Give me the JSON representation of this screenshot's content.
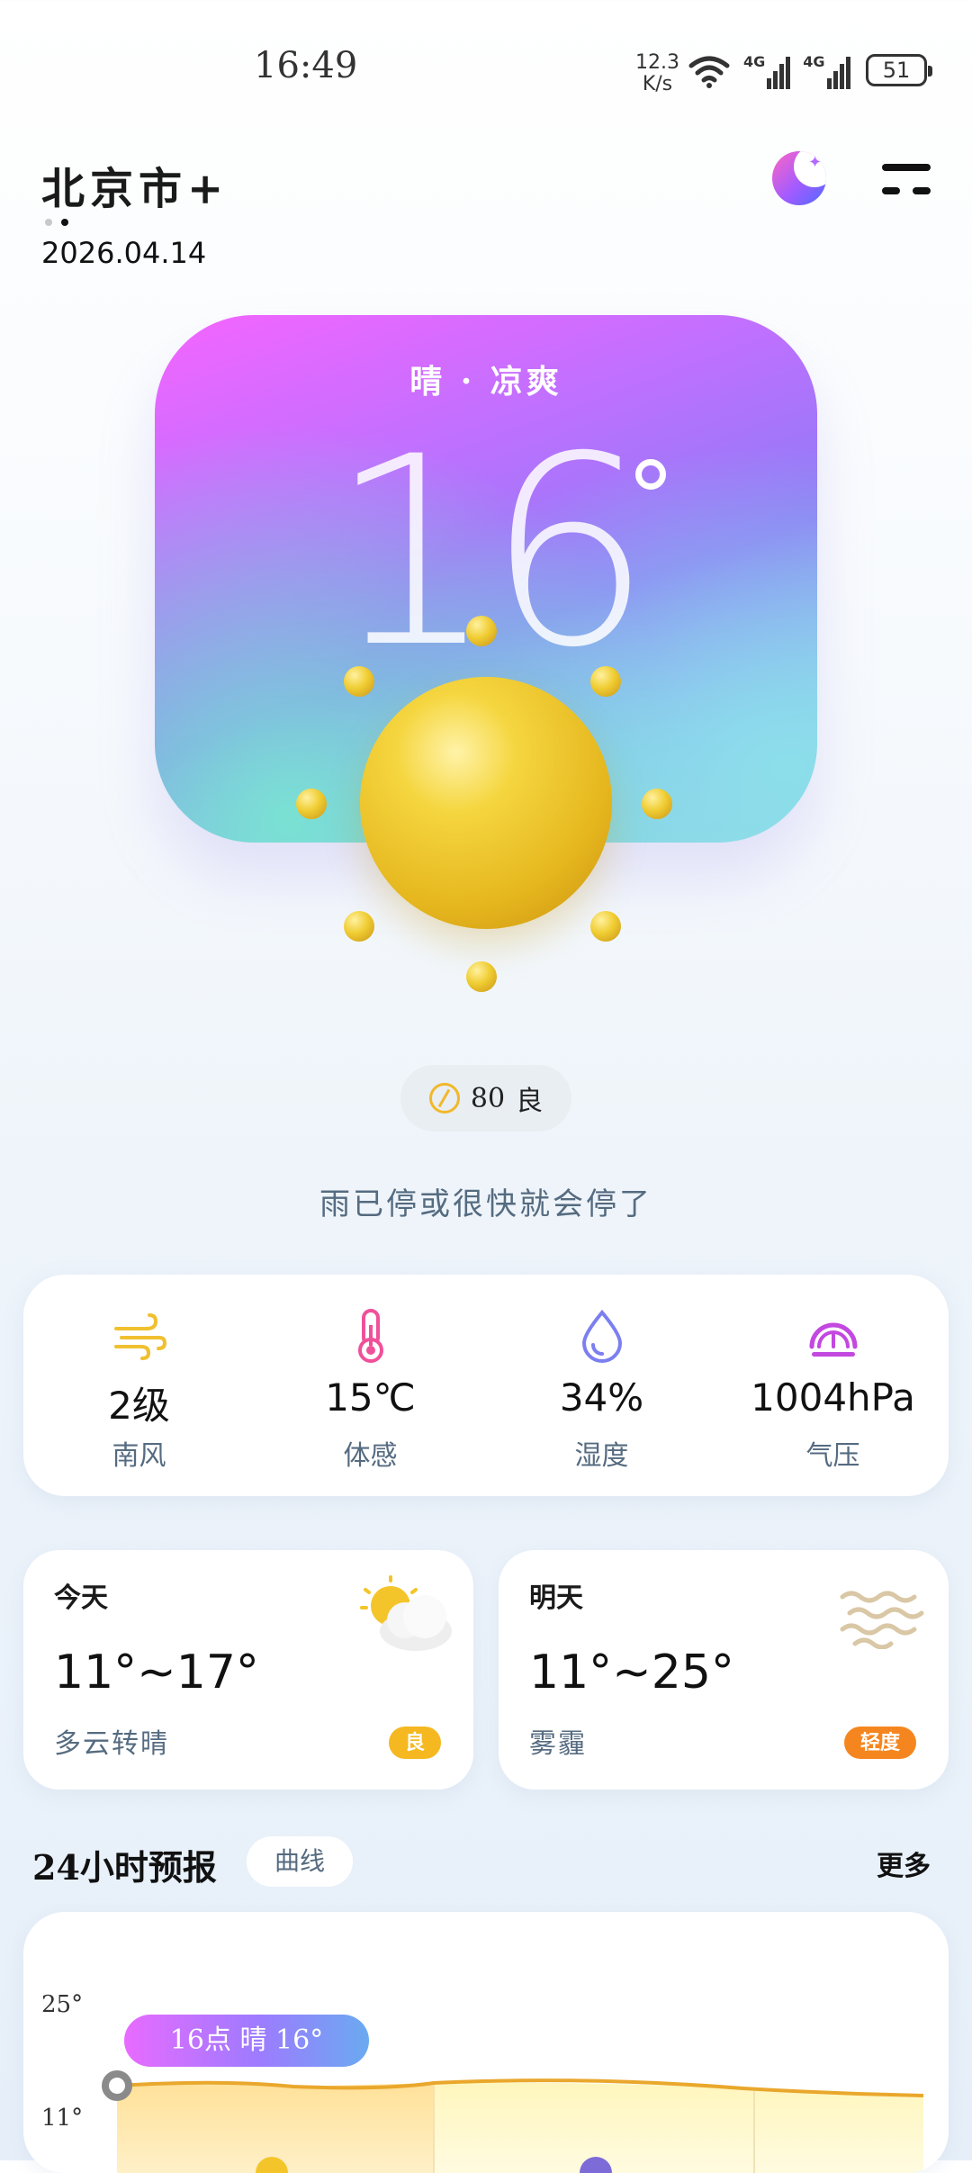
{
  "status_bar": {
    "time": "16:49",
    "net_speed_value": "12.3",
    "net_speed_unit": "K/s",
    "signal_1": "4G",
    "signal_2": "4G",
    "battery": "51",
    "icons": [
      "wifi-icon",
      "signal-4g-icon",
      "signal-4g-icon",
      "battery-icon"
    ]
  },
  "header": {
    "city": "北京市",
    "add_icon": "+",
    "date": "2026.04.14",
    "page_dots": 2,
    "active_dot": 1
  },
  "current": {
    "condition": "晴 · 凉爽",
    "temperature": "16",
    "weather_icon": "sun-icon"
  },
  "aqi": {
    "value": "80",
    "level": "良",
    "icon": "leaf-icon"
  },
  "rain_note": "雨已停或很快就会停了",
  "metrics": [
    {
      "value": "2级",
      "label": "南风",
      "icon": "wind-icon",
      "color": "#f0c02f"
    },
    {
      "value": "15℃",
      "label": "体感",
      "icon": "thermometer-icon",
      "color": "#f0509a"
    },
    {
      "value": "34%",
      "label": "湿度",
      "icon": "droplet-icon",
      "color": "#7b7ff0"
    },
    {
      "value": "1004hPa",
      "label": "气压",
      "icon": "gauge-icon",
      "color": "#c348e0"
    }
  ],
  "days": {
    "today": {
      "label": "今天",
      "range": "11°~17°",
      "desc": "多云转晴",
      "badge": "良",
      "badge_color": "#f5b820",
      "icon": "partly-cloudy-icon"
    },
    "tomorrow": {
      "label": "明天",
      "range": "11°~25°",
      "desc": "雾霾",
      "badge": "轻度",
      "badge_color": "#f5861f",
      "icon": "haze-icon"
    }
  },
  "forecast_24h": {
    "title": "24小时预报",
    "tab": "曲线",
    "more": "更多",
    "y_ticks": [
      "25°",
      "11°"
    ],
    "bubble": "16点 晴 16°"
  }
}
